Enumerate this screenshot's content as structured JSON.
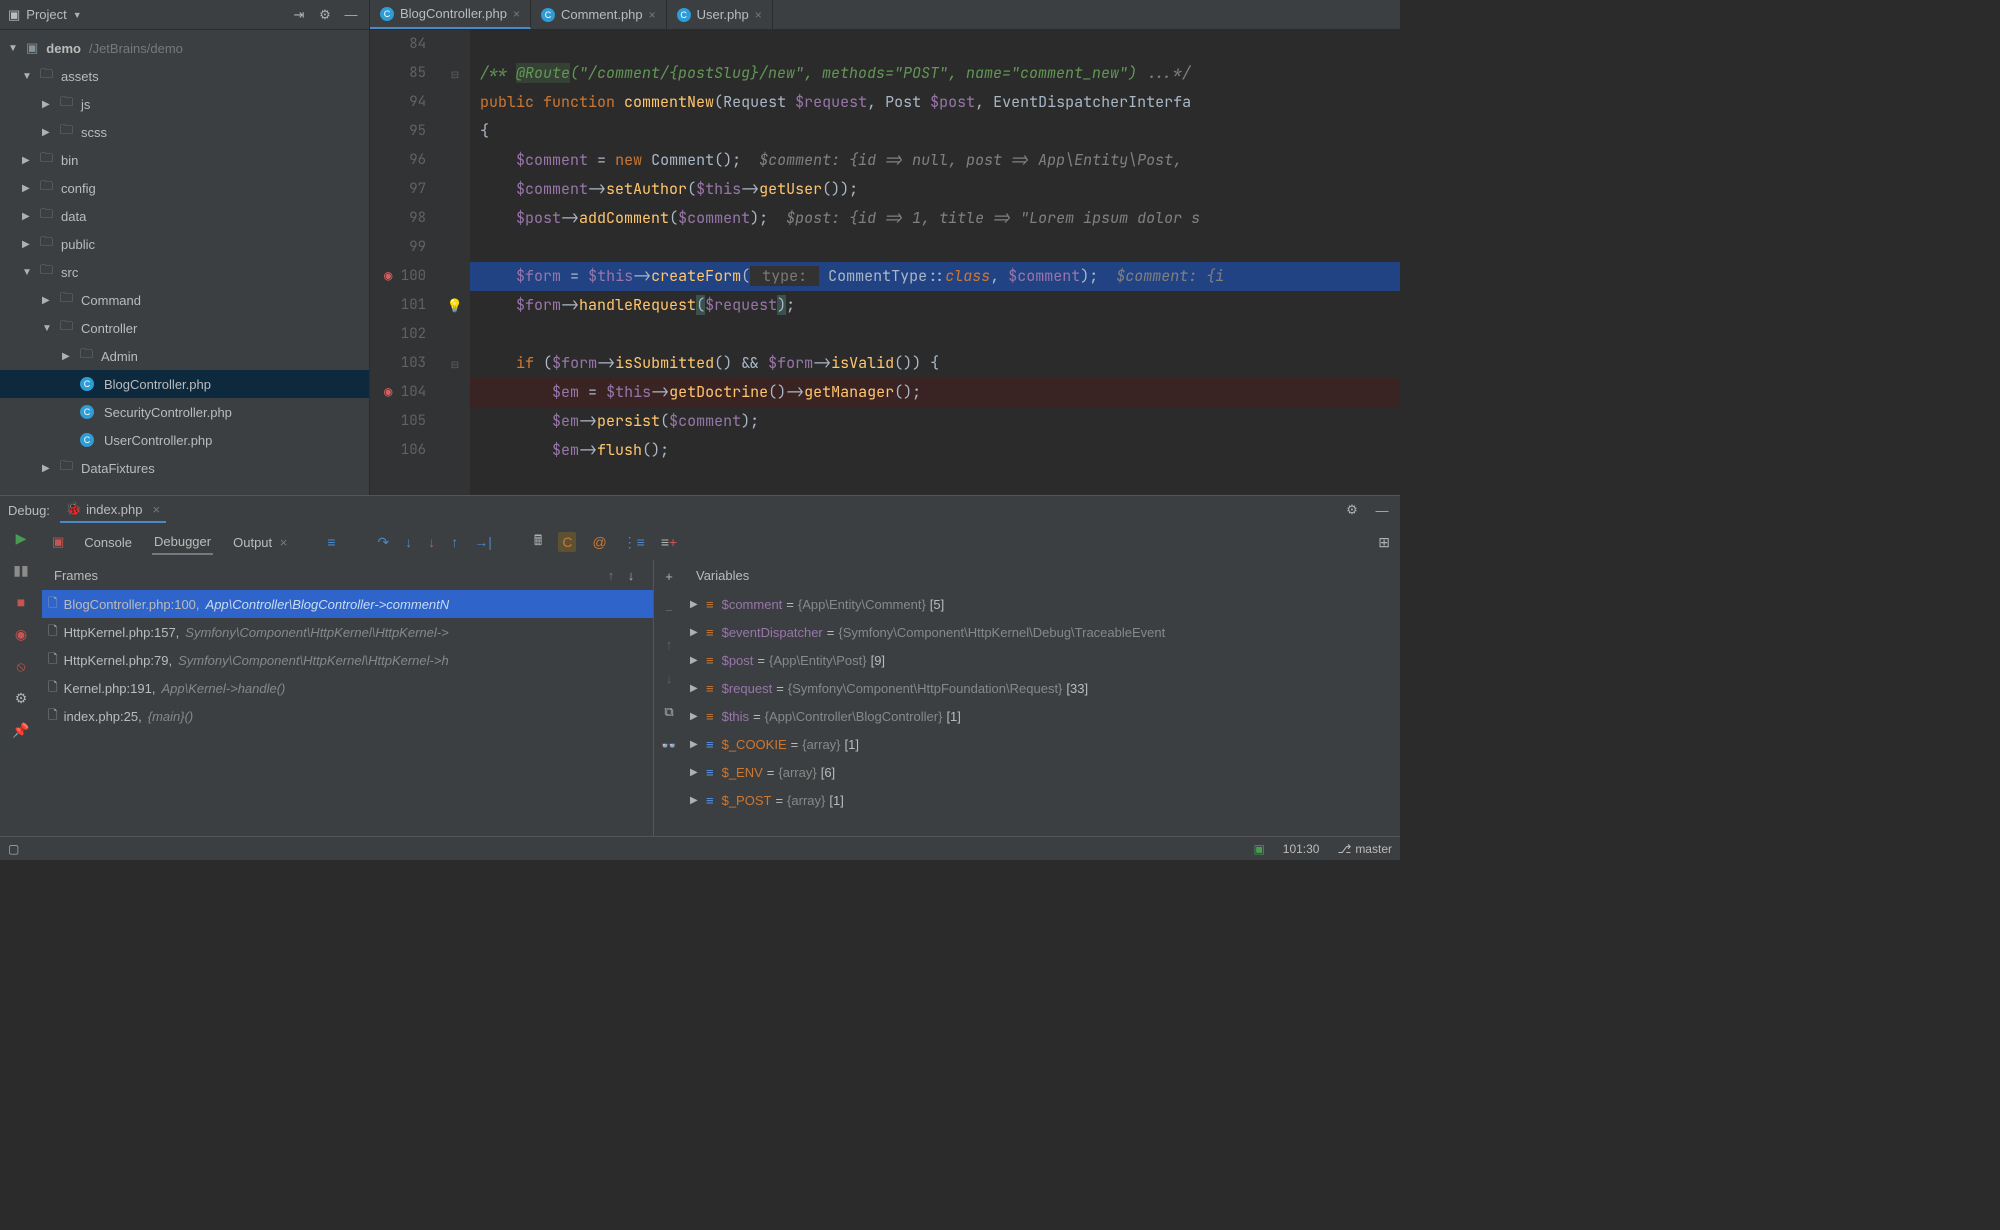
{
  "project": {
    "label": "Project",
    "root": {
      "name": "demo",
      "path": "/JetBrains/demo"
    },
    "tree": [
      {
        "type": "folder",
        "name": "assets",
        "expanded": true,
        "indent": 1
      },
      {
        "type": "folder",
        "name": "js",
        "expanded": false,
        "indent": 2
      },
      {
        "type": "folder",
        "name": "scss",
        "expanded": false,
        "indent": 2
      },
      {
        "type": "folder",
        "name": "bin",
        "expanded": false,
        "indent": 1
      },
      {
        "type": "folder",
        "name": "config",
        "expanded": false,
        "indent": 1
      },
      {
        "type": "folder",
        "name": "data",
        "expanded": false,
        "indent": 1
      },
      {
        "type": "folder",
        "name": "public",
        "expanded": false,
        "indent": 1
      },
      {
        "type": "folder",
        "name": "src",
        "expanded": true,
        "indent": 1
      },
      {
        "type": "folder",
        "name": "Command",
        "expanded": false,
        "indent": 2
      },
      {
        "type": "folder",
        "name": "Controller",
        "expanded": true,
        "indent": 2
      },
      {
        "type": "folder",
        "name": "Admin",
        "expanded": false,
        "indent": 3
      },
      {
        "type": "php",
        "name": "BlogController.php",
        "indent": 3,
        "selected": true
      },
      {
        "type": "php",
        "name": "SecurityController.php",
        "indent": 3
      },
      {
        "type": "php",
        "name": "UserController.php",
        "indent": 3
      },
      {
        "type": "folder",
        "name": "DataFixtures",
        "expanded": false,
        "indent": 2
      }
    ]
  },
  "editor": {
    "tabs": [
      {
        "label": "BlogController.php",
        "active": true
      },
      {
        "label": "Comment.php",
        "active": false
      },
      {
        "label": "User.php",
        "active": false
      }
    ],
    "gutterStart": 84,
    "lines": [
      {
        "n": 84,
        "text": ""
      },
      {
        "n": 85,
        "doc": true,
        "text": "/** @Route(\"/comment/{postSlug}/new\", methods=\"POST\", name=\"comment_new\") ...*/"
      },
      {
        "n": 94,
        "text": "public function commentNew(Request $request, Post $post, EventDispatcherInterfa"
      },
      {
        "n": 95,
        "text": "{"
      },
      {
        "n": 96,
        "text": "    $comment = new Comment();  $comment: {id => null, post => App\\Entity\\Post, "
      },
      {
        "n": 97,
        "text": "    $comment->setAuthor($this->getUser());"
      },
      {
        "n": 98,
        "text": "    $post->addComment($comment);  $post: {id => 1, title => \"Lorem ipsum dolor s"
      },
      {
        "n": 99,
        "text": ""
      },
      {
        "n": 100,
        "bp": true,
        "current": true,
        "text": "    $form = $this->createForm( type: CommentType::class, $comment);  $comment: {i"
      },
      {
        "n": 101,
        "lightbulb": true,
        "text": "    $form->handleRequest($request);"
      },
      {
        "n": 102,
        "text": ""
      },
      {
        "n": 103,
        "text": "    if ($form->isSubmitted() && $form->isValid()) {"
      },
      {
        "n": 104,
        "bp": true,
        "text": "        $em = $this->getDoctrine()->getManager();"
      },
      {
        "n": 105,
        "text": "        $em->persist($comment);"
      },
      {
        "n": 106,
        "text": "        $em->flush();"
      }
    ]
  },
  "debug": {
    "label": "Debug:",
    "session": "index.php",
    "tabs": {
      "console": "Console",
      "debugger": "Debugger",
      "output": "Output"
    },
    "frames": {
      "label": "Frames",
      "items": [
        {
          "loc": "BlogController.php:100,",
          "detail": "App\\Controller\\BlogController->commentN",
          "selected": true
        },
        {
          "loc": "HttpKernel.php:157,",
          "detail": "Symfony\\Component\\HttpKernel\\HttpKernel->"
        },
        {
          "loc": "HttpKernel.php:79,",
          "detail": "Symfony\\Component\\HttpKernel\\HttpKernel->h"
        },
        {
          "loc": "Kernel.php:191,",
          "detail": "App\\Kernel->handle()"
        },
        {
          "loc": "index.php:25,",
          "detail": "{main}()"
        }
      ]
    },
    "variables": {
      "label": "Variables",
      "items": [
        {
          "name": "$comment",
          "type": "{App\\Entity\\Comment}",
          "count": "[5]",
          "kind": "obj"
        },
        {
          "name": "$eventDispatcher",
          "type": "{Symfony\\Component\\HttpKernel\\Debug\\TraceableEvent",
          "count": "",
          "kind": "obj"
        },
        {
          "name": "$post",
          "type": "{App\\Entity\\Post}",
          "count": "[9]",
          "kind": "obj"
        },
        {
          "name": "$request",
          "type": "{Symfony\\Component\\HttpFoundation\\Request}",
          "count": "[33]",
          "kind": "obj"
        },
        {
          "name": "$this",
          "type": "{App\\Controller\\BlogController}",
          "count": "[1]",
          "kind": "obj"
        },
        {
          "name": "$_COOKIE",
          "type": "{array}",
          "count": "[1]",
          "kind": "global"
        },
        {
          "name": "$_ENV",
          "type": "{array}",
          "count": "[6]",
          "kind": "global"
        },
        {
          "name": "$_POST",
          "type": "{array}",
          "count": "[1]",
          "kind": "global"
        }
      ]
    }
  },
  "status": {
    "cursor": "101:30",
    "branch": "master"
  }
}
